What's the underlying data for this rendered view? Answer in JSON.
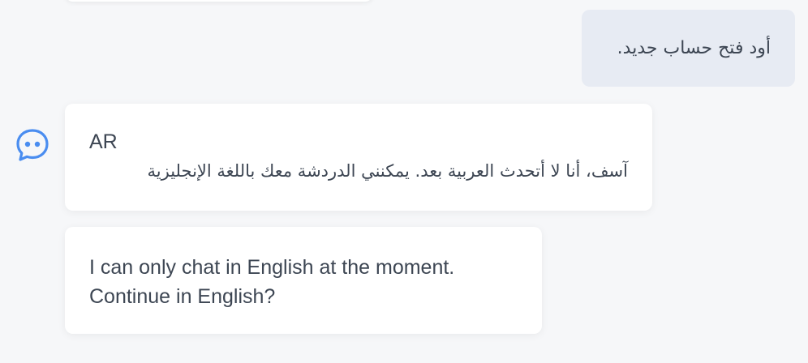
{
  "conversation": {
    "user_message": "أود فتح حساب جديد.",
    "bot_messages": {
      "language_tag": "AR",
      "arabic_reply": "آسف، أنا لا أتحدث العربية بعد. يمكنني الدردشة معك باللغة الإنجليزية",
      "english_line_1": "I can only chat in English at the moment.",
      "english_line_2": "Continue in English?"
    }
  },
  "icons": {
    "bot_avatar": "chat-bubble-dots-icon"
  },
  "colors": {
    "accent": "#4a8df0",
    "user_bubble": "#e7ebf3",
    "bot_bubble": "#ffffff",
    "background": "#f6f7f9",
    "text": "#3d4653"
  }
}
